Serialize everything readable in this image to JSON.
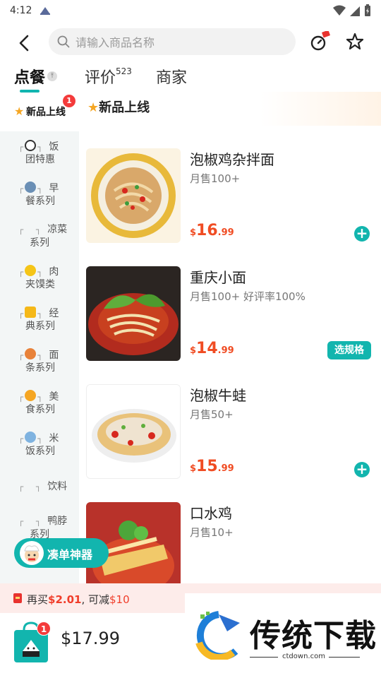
{
  "status_bar": {
    "time": "4:12"
  },
  "header": {
    "search_placeholder": "请输入商品名称"
  },
  "tabs": [
    {
      "label": "点餐",
      "count": ""
    },
    {
      "label": "评价",
      "count": "523"
    },
    {
      "label": "商家",
      "count": ""
    }
  ],
  "sidebar": {
    "active": {
      "label": "新品上线",
      "badge": "1"
    },
    "items": [
      {
        "line1": "饭",
        "line2": "团特惠",
        "icon": "rice-ball-icon"
      },
      {
        "line1": "早",
        "line2": "餐系列",
        "icon": "plate-icon"
      },
      {
        "line1": "凉菜",
        "line2": "系列",
        "icon": ""
      },
      {
        "line1": "肉",
        "line2": "夹馍类",
        "icon": "smile-icon"
      },
      {
        "line1": "经",
        "line2": "典系列",
        "icon": "thumbs-up-icon"
      },
      {
        "line1": "面",
        "line2": "条系列",
        "icon": "noodle-bowl-icon"
      },
      {
        "line1": "美",
        "line2": "食系列",
        "icon": "love-face-icon"
      },
      {
        "line1": "米",
        "line2": "饭系列",
        "icon": "rice-bowl-icon"
      },
      {
        "line1": "饮料",
        "line2": "",
        "icon": ""
      },
      {
        "line1": "鸭脖",
        "line2": "系列",
        "icon": ""
      }
    ]
  },
  "section": {
    "title": "新品上线"
  },
  "products": [
    {
      "name": "泡椒鸡杂拌面",
      "sold": "月售100+",
      "currency": "$",
      "price_int": "16",
      "price_dec": ".99",
      "action": "add"
    },
    {
      "name": "重庆小面",
      "sold": "月售100+ 好评率100%",
      "currency": "$",
      "price_int": "14",
      "price_dec": ".99",
      "action": "选规格"
    },
    {
      "name": "泡椒牛蛙",
      "sold": "月售50+",
      "currency": "$",
      "price_int": "15",
      "price_dec": ".99",
      "action": "add"
    },
    {
      "name": "口水鸡",
      "sold": "月售10+",
      "currency": "$",
      "price_int": "",
      "price_dec": "",
      "action": "add"
    }
  ],
  "combo_button": {
    "label": "凑单神器"
  },
  "promo": {
    "prefix": "再买",
    "amount": "$2.01",
    "sep": ", 可减",
    "discount": "$10"
  },
  "cart": {
    "badge": "1",
    "total": "$17.99"
  },
  "watermark": {
    "title": "传统下载",
    "url": "ctdown.com"
  },
  "colors": {
    "accent": "#12b5ae",
    "price": "#f04c23",
    "badge": "#f43b3b"
  }
}
